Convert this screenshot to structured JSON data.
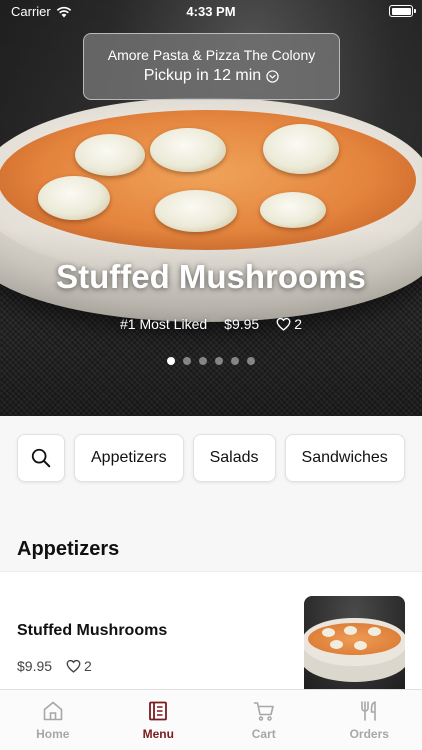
{
  "status_bar": {
    "carrier": "Carrier",
    "time": "4:33 PM"
  },
  "restaurant": {
    "name": "Amore Pasta & Pizza The Colony",
    "pickup": "Pickup in 12 min"
  },
  "hero": {
    "title": "Stuffed Mushrooms",
    "rank": "#1 Most Liked",
    "price": "$9.95",
    "likes": "2",
    "slides_total": 6,
    "active_slide": 1
  },
  "categories": {
    "items": [
      "Appetizers",
      "Salads",
      "Sandwiches"
    ]
  },
  "section": {
    "title": "Appetizers"
  },
  "items": [
    {
      "name": "Stuffed Mushrooms",
      "price": "$9.95",
      "likes": "2"
    }
  ],
  "tabs": [
    {
      "label": "Home",
      "icon": "home-icon"
    },
    {
      "label": "Menu",
      "icon": "menu-icon",
      "active": true
    },
    {
      "label": "Cart",
      "icon": "cart-icon"
    },
    {
      "label": "Orders",
      "icon": "fork-knife-icon"
    }
  ],
  "colors": {
    "accent": "#7a1b1d",
    "inactive_tab": "#a7a7a7"
  }
}
